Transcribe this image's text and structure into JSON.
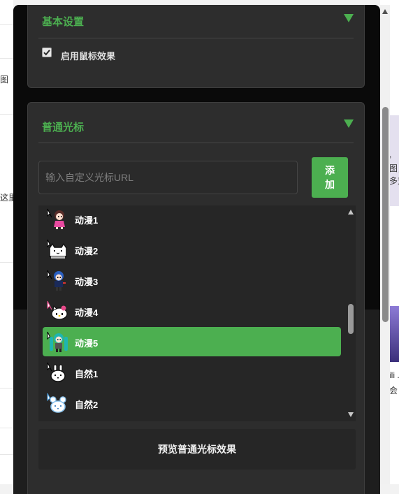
{
  "background": {
    "left_fragments": [
      "图",
      "这里"
    ],
    "right_fragments": [
      ",",
      "图，",
      "多对",
      "ili .",
      "会"
    ]
  },
  "basic_settings": {
    "title": "基本设置",
    "enable_mouse_effect_label": "启用鼠标效果",
    "enable_mouse_effect_checked": true
  },
  "normal_cursor": {
    "title": "普通光标",
    "url_placeholder": "输入自定义光标URL",
    "add_button": "添\n加",
    "items": [
      {
        "name": "动漫1",
        "icon": "anime-girl-pink-icon",
        "selected": false
      },
      {
        "name": "动漫2",
        "icon": "pixel-cat-icon",
        "selected": false
      },
      {
        "name": "动漫3",
        "icon": "anime-boy-blue-icon",
        "selected": false
      },
      {
        "name": "动漫4",
        "icon": "hello-kitty-icon",
        "selected": false
      },
      {
        "name": "动漫5",
        "icon": "miku-icon",
        "selected": true
      },
      {
        "name": "自然1",
        "icon": "pixel-rabbit-icon",
        "selected": false
      },
      {
        "name": "自然2",
        "icon": "pixel-blue-rabbit-icon",
        "selected": false
      }
    ],
    "preview_button": "预览普通光标效果"
  },
  "colors": {
    "accent": "#4caf50",
    "panel_bg": "#0a0a0a",
    "card_bg": "#2d2d2d",
    "list_bg": "#262626"
  }
}
